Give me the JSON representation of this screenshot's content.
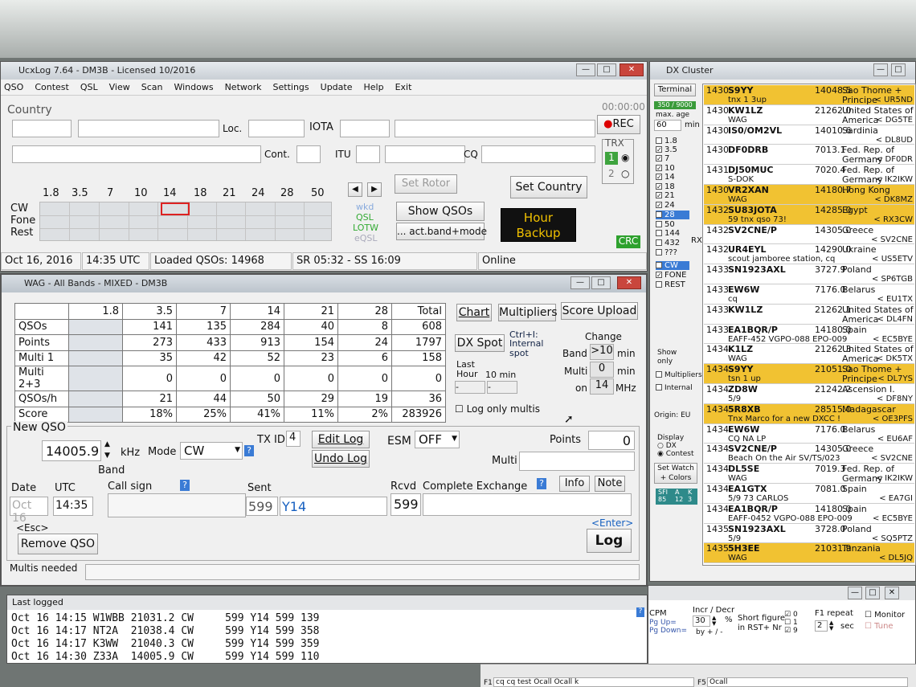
{
  "main": {
    "title": "UcxLog 7.64 - DM3B - Licensed 10/2016",
    "menu": [
      "QSO",
      "Contest",
      "QSL",
      "View",
      "Scan",
      "Windows",
      "Network",
      "Settings",
      "Update",
      "Help",
      "Exit"
    ],
    "country_label": "Country",
    "loc_label": "Loc.",
    "iota_label": "IOTA",
    "cont_label": "Cont.",
    "itu_label": "ITU",
    "cq_label": "CQ",
    "timer": "00:00:00",
    "rec_label": "REC",
    "trx_label": "TRX",
    "trx1": "1",
    "trx2": "2",
    "bands": [
      "1.8",
      "3.5",
      "7",
      "10",
      "14",
      "18",
      "21",
      "24",
      "28",
      "50"
    ],
    "modes": [
      "CW",
      "Fone",
      "Rest"
    ],
    "legend": [
      "wkd",
      "QSL",
      "LOTW",
      "eQSL"
    ],
    "set_rotor": "Set Rotor",
    "set_country": "Set Country",
    "show_qsos": "Show QSOs",
    "act_band": "... act.band+mode",
    "hour_backup": [
      "Hour",
      "Backup"
    ],
    "crc": "CRC",
    "status": {
      "date": "Oct 16, 2016",
      "utc": "14:35 UTC",
      "loaded": "Loaded QSOs: 14968",
      "sun": "SR 05:32 - SS 16:09",
      "online": "Online"
    }
  },
  "wag": {
    "title": "WAG - All Bands - MIXED - DM3B",
    "headers": [
      "",
      "1.8",
      "3.5",
      "7",
      "14",
      "21",
      "28",
      "Total"
    ],
    "rows": [
      [
        "QSOs",
        "",
        "141",
        "135",
        "284",
        "40",
        "8",
        "608"
      ],
      [
        "Points",
        "",
        "273",
        "433",
        "913",
        "154",
        "24",
        "1797"
      ],
      [
        "Multi 1",
        "",
        "35",
        "42",
        "52",
        "23",
        "6",
        "158"
      ],
      [
        "Multi 2+3",
        "",
        "0",
        "0",
        "0",
        "0",
        "0",
        "0"
      ],
      [
        "QSOs/h",
        "",
        "21",
        "44",
        "50",
        "29",
        "19",
        "36"
      ],
      [
        "Score",
        "",
        "18%",
        "25%",
        "41%",
        "11%",
        "2%",
        "283926"
      ]
    ],
    "chart": "Chart",
    "multipliers": "Multipliers",
    "score_upload": "Score Upload",
    "dx_spot": "DX Spot",
    "ctrl_i": "Ctrl+I:",
    "internal_spot": "Internal spot",
    "last_hour": "Last Hour",
    "ten_min": "10 min",
    "dash1": "-",
    "dash2": "-",
    "change": "Change",
    "band_lbl": "Band",
    "band_val": ">10",
    "min1": "min",
    "multi_lbl": "Multi",
    "multi_val": "0",
    "min2": "min",
    "on_lbl": "on",
    "on_val": "14",
    "mhz": "MHz",
    "log_only": "Log only multis",
    "new_qso": "New QSO",
    "freq": "14005.9",
    "khz": "kHz",
    "mode_lbl": "Mode",
    "mode_val": "CW",
    "band": "Band",
    "txid_lbl": "TX ID",
    "txid_val": "4",
    "edit_log": "Edit Log",
    "undo_log": "Undo Log",
    "esm_lbl": "ESM",
    "esm_val": "OFF",
    "points_lbl": "Points",
    "points_val": "0",
    "multi_field": "Multi",
    "date_lbl": "Date",
    "utc_lbl": "UTC",
    "call_lbl": "Call sign",
    "sent_lbl": "Sent",
    "rcvd_lbl": "Rcvd",
    "exch_lbl": "Complete Exchange",
    "info": "Info",
    "note": "Note",
    "date_val": "Oct 16",
    "utc_val": "14:35",
    "sent_rst": "599",
    "sent_exch": "Y14",
    "rcvd_val": "599",
    "esc": "<Esc>",
    "remove": "Remove QSO",
    "enter": "<Enter>",
    "log": "Log",
    "multis_needed": "Multis needed",
    "help_q": "?"
  },
  "cluster": {
    "title": "DX Cluster",
    "terminal": "Terminal",
    "count": "350 / 9000",
    "max_age": "max. age",
    "age_val": "60",
    "min": "min",
    "bands": [
      [
        "1.8",
        false
      ],
      [
        "3.5",
        true
      ],
      [
        "7",
        true
      ],
      [
        "10",
        true
      ],
      [
        "14",
        true
      ],
      [
        "18",
        true
      ],
      [
        "21",
        true
      ],
      [
        "24",
        true
      ],
      [
        "28",
        true
      ],
      [
        "50",
        false
      ],
      [
        "144",
        false
      ],
      [
        "432",
        false
      ],
      [
        "???",
        false
      ]
    ],
    "modes": [
      [
        "CW",
        true
      ],
      [
        "FONE",
        true
      ],
      [
        "REST",
        false
      ]
    ],
    "rx": "RX",
    "show_only": "Show only",
    "multipliers": "Multipliers",
    "internal": "Internal",
    "origin": "Origin: EU",
    "display": "Display",
    "dx": "DX",
    "contest": "Contest",
    "set_watch": "Set Watch + Colors",
    "sfi": [
      "SFI",
      "A",
      "K"
    ],
    "sfi_v": [
      "85",
      "12",
      "3"
    ],
    "spots": [
      [
        "1430",
        "S9YY",
        "14048.5",
        "Sao Thome + Principe",
        "tnx 1 3up",
        "< UR5ND",
        true
      ],
      [
        "1430",
        "KW1LZ",
        "21262.0",
        "United States of America",
        "WAG",
        "< DG5TE",
        false
      ],
      [
        "1430",
        "IS0/OM2VL",
        "14010.6",
        "Sardinia",
        "",
        "< DL8UD",
        false
      ],
      [
        "1430",
        "DF0DRB",
        "7013.1",
        "Fed. Rep. of Germany",
        "",
        "< DF0DR",
        false
      ],
      [
        "1431",
        "DJ50MUC",
        "7020.4",
        "Fed. Rep. of Germany",
        "S-DOK",
        "< IK2IKW",
        false
      ],
      [
        "1430",
        "VR2XAN",
        "14180.7",
        "Hong Kong",
        "WAG",
        "< DK8MZ",
        true
      ],
      [
        "1432",
        "SU83JOTA",
        "14285.0",
        "Egypt",
        "59 tnx qso 73!",
        "< RX3CW",
        true
      ],
      [
        "1432",
        "SV2CNE/P",
        "14305.0",
        "Greece",
        "",
        "< SV2CNE",
        false
      ],
      [
        "1432",
        "UR4EYL",
        "14290.0",
        "Ukraine",
        "scout jamboree station, cq",
        "< US5ETV",
        false
      ],
      [
        "1433",
        "SN1923AXL",
        "3727.9",
        "Poland",
        "",
        "< SP6TGB",
        false
      ],
      [
        "1433",
        "EW6W",
        "7176.0",
        "Belarus",
        "cq",
        "< EU1TX",
        false
      ],
      [
        "1433",
        "KW1LZ",
        "21262.1",
        "United States of America",
        "",
        "< DL4FN",
        false
      ],
      [
        "1433",
        "EA1BQR/P",
        "14180.0",
        "Spain",
        "EAFF-452 VGPO-088 EPO-009",
        "< EC5BYE",
        false
      ],
      [
        "1434",
        "K1LZ",
        "21262.3",
        "United States of America",
        "WAG",
        "< DK5TX",
        false
      ],
      [
        "1434",
        "S9YY",
        "21051.0",
        "Sao Thome + Principe",
        "tsn 1 up",
        "< DL7YS",
        true
      ],
      [
        "1434",
        "ZD8W",
        "21242.2",
        "Ascension I.",
        "5/9",
        "< DF8NY",
        false
      ],
      [
        "1434",
        "5R8XB",
        "28515.0",
        "Madagascar",
        "Tnx Marco for a new DXCC !",
        "< OE3PFS",
        true
      ],
      [
        "1434",
        "EW6W",
        "7176.0",
        "Belarus",
        "CQ NA LP",
        "< EU6AF",
        false
      ],
      [
        "1434",
        "SV2CNE/P",
        "14305.0",
        "Greece",
        "Beach On the Air SV/TS/023",
        "< SV2CNE",
        false
      ],
      [
        "1434",
        "DL5SE",
        "7019.3",
        "Fed. Rep. of Germany",
        "WAG",
        "< IK2IKW",
        false
      ],
      [
        "1434",
        "EA1GTX",
        "7081.0",
        "Spain",
        "5/9 73 CARLOS",
        "< EA7GI",
        false
      ],
      [
        "1434",
        "EA1BQR/P",
        "14180.0",
        "Spain",
        "EAFF-0452 VGPO-088 EPO-009",
        "< EC5BYE",
        false
      ],
      [
        "1435",
        "SN1923AXL",
        "3728.0",
        "Poland",
        "5/9",
        "< SQ5PTZ",
        false
      ],
      [
        "1435",
        "5H3EE",
        "21031.9",
        "Tanzania",
        "WAG",
        "< DL5JQ",
        true
      ]
    ]
  },
  "lastlog": {
    "title": "Last logged",
    "rows": [
      "Oct 16 14:15 W1WBB 21031.2 CW     599 Y14 599 139",
      "Oct 16 14:17 NT2A  21038.4 CW     599 Y14 599 358",
      "Oct 16 14:17 K3WW  21040.3 CW     599 Y14 599 359",
      "Oct 16 14:30 Z33A  14005.9 CW     599 Y14 599 110"
    ]
  },
  "cw": {
    "cpm": "CPM",
    "pgup": "Pg Up=",
    "pgdn": "Pg Down=",
    "incr": "Incr / Decr",
    "incr_val": "30",
    "pct": "%",
    "by": "by + / -",
    "short_fig": "Short figure",
    "in_rst": "in RST+ Nr",
    "f1": "F1 repeat",
    "f1_val": "2",
    "sec": "sec",
    "monitor": "Monitor",
    "tune": "Tune",
    "cbx": [
      "0",
      "1",
      "9"
    ],
    "f1_field": "cq cq test Ocall  Ocall k",
    "f1_lbl": "F1",
    "f5_lbl": "F5",
    "f5_field": "Ocall"
  }
}
